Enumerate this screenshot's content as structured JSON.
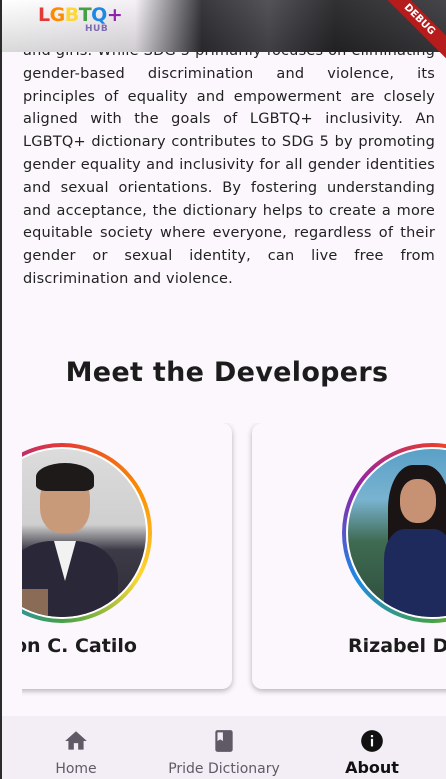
{
  "header": {
    "logo_letters": [
      "L",
      "G",
      "B",
      "T",
      "Q",
      "+"
    ],
    "logo_sub": "HUB",
    "debug_label": "DEBUG"
  },
  "about": {
    "paragraph": "and girls. While SDG 5 primarily focuses on eliminating gender-based discrimination and violence, its principles of equality and empowerment are closely aligned with the goals of LGBTQ+ inclusivity. An LGBTQ+ dictionary contributes to SDG 5 by promoting gender equality and inclusivity for all gender identities and sexual orientations. By fostering understanding and acceptance, the dictionary helps to create a more equitable society where everyone, regardless of their gender or sexual identity, can live free from discrimination and violence.",
    "developers_title": "Meet the Developers",
    "developers": [
      {
        "name": "on C. Catilo"
      },
      {
        "name": "Rizabel D"
      }
    ]
  },
  "nav": {
    "items": [
      {
        "label": "Home",
        "icon": "home-icon"
      },
      {
        "label": "Pride Dictionary",
        "icon": "book-icon"
      },
      {
        "label": "About",
        "icon": "info-icon"
      }
    ],
    "active": "About"
  },
  "colors": {
    "background": "#fbf7fc",
    "nav_background": "#f3edf6",
    "debug_banner": "#b71c1c"
  }
}
